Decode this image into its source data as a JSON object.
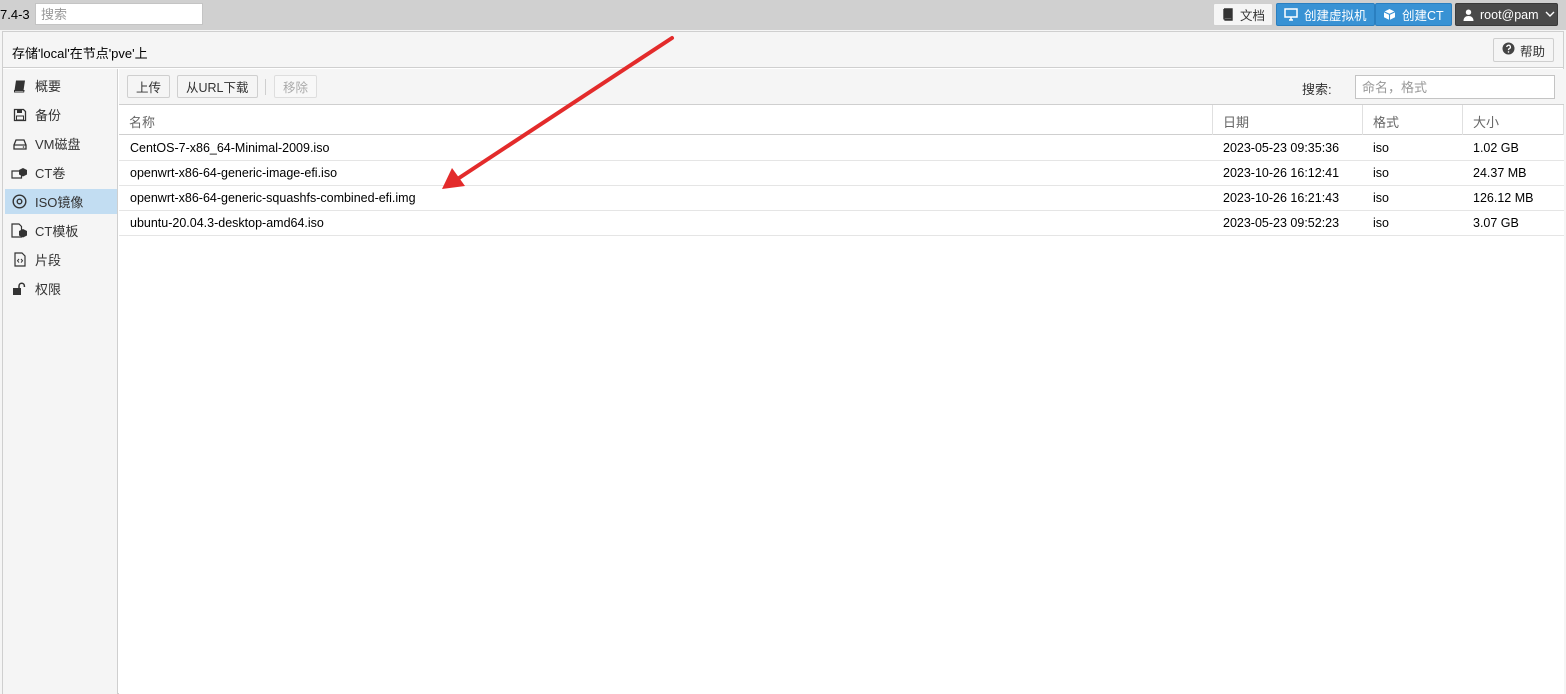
{
  "topbar": {
    "version": "7.4-3",
    "search_placeholder": "搜索",
    "docs_label": "文档",
    "create_vm_label": "创建虚拟机",
    "create_ct_label": "创建CT",
    "user_label": "root@pam"
  },
  "panel": {
    "title": "存储'local'在节点'pve'上",
    "help_label": "帮助"
  },
  "sidebar": {
    "items": [
      {
        "label": "概要",
        "icon": "book-icon"
      },
      {
        "label": "备份",
        "icon": "floppy-icon"
      },
      {
        "label": "VM磁盘",
        "icon": "hdd-icon"
      },
      {
        "label": "CT卷",
        "icon": "ct-volume-icon"
      },
      {
        "label": "ISO镜像",
        "icon": "disc-icon",
        "active": true
      },
      {
        "label": "CT模板",
        "icon": "ct-template-icon"
      },
      {
        "label": "片段",
        "icon": "code-file-icon"
      },
      {
        "label": "权限",
        "icon": "unlock-icon"
      }
    ]
  },
  "toolbar": {
    "upload_label": "上传",
    "download_url_label": "从URL下载",
    "remove_label": "移除",
    "search_label": "搜索:",
    "search_placeholder": "命名，格式"
  },
  "grid": {
    "columns": [
      "名称",
      "日期",
      "格式",
      "大小"
    ],
    "rows": [
      {
        "name": "CentOS-7-x86_64-Minimal-2009.iso",
        "date": "2023-05-23 09:35:36",
        "format": "iso",
        "size": "1.02 GB"
      },
      {
        "name": "openwrt-x86-64-generic-image-efi.iso",
        "date": "2023-10-26 16:12:41",
        "format": "iso",
        "size": "24.37 MB"
      },
      {
        "name": "openwrt-x86-64-generic-squashfs-combined-efi.img",
        "date": "2023-10-26 16:21:43",
        "format": "iso",
        "size": "126.12 MB"
      },
      {
        "name": "ubuntu-20.04.3-desktop-amd64.iso",
        "date": "2023-05-23 09:52:23",
        "format": "iso",
        "size": "3.07 GB"
      }
    ]
  },
  "colors": {
    "accent_blue": "#3892d4",
    "active_nav": "#c2ddf2",
    "annotation_arrow": "#e32b2b"
  }
}
